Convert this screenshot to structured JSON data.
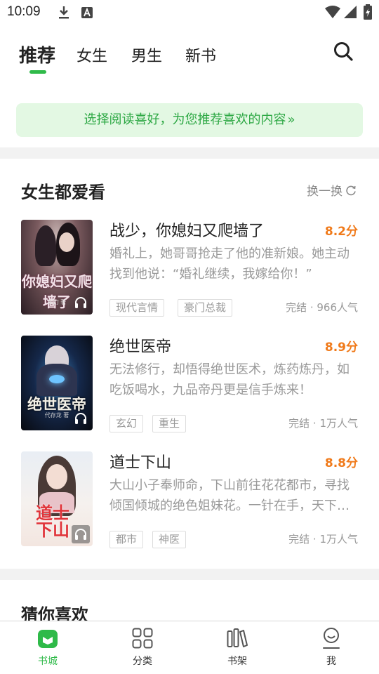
{
  "status_bar": {
    "time": "10:09",
    "icons": [
      "download-icon",
      "font-icon",
      "wifi-icon",
      "signal-icon",
      "battery-icon"
    ]
  },
  "header": {
    "tabs": [
      {
        "label": "推荐",
        "active": true
      },
      {
        "label": "女生",
        "active": false
      },
      {
        "label": "男生",
        "active": false
      },
      {
        "label": "新书",
        "active": false
      }
    ],
    "search_icon": "search-icon"
  },
  "preference_banner": {
    "text": "选择阅读喜好，为您推荐喜欢的内容",
    "chevron": "»"
  },
  "section_female": {
    "title": "女生都爱看",
    "refresh_label": "换一换",
    "books": [
      {
        "title": "战少，你媳妇又爬墙了",
        "score": "8.2分",
        "desc": "婚礼上，她哥哥抢走了他的准新娘。她主动找到他说：“婚礼继续，我嫁给你！”",
        "tags": [
          "现代言情",
          "豪门总裁"
        ],
        "meta": "完结 · 966人气",
        "cover_text": "你媳妇又爬墙了",
        "cover_author": "紫幻 著"
      },
      {
        "title": "绝世医帝",
        "score": "8.9分",
        "desc": "无法修行，却悟得绝世医术，炼药炼丹，如吃饭喝水，九品帝丹更是信手炼来！",
        "tags": [
          "玄幻",
          "重生"
        ],
        "meta": "完结 · 1万人气",
        "cover_text": "绝世医帝",
        "cover_author": "代存龙 著"
      },
      {
        "title": "道士下山",
        "score": "8.8分",
        "desc": "大山小子奉师命，下山前往花花都市，寻找倾国倾城的绝色姐妹花。一针在手，天下我有！",
        "tags": [
          "都市",
          "神医"
        ],
        "meta": "完结 · 1万人气",
        "cover_text": "道士下山",
        "cover_author": ""
      }
    ]
  },
  "section_guess": {
    "title": "猜你喜欢"
  },
  "bottom_nav": [
    {
      "label": "书城",
      "icon": "bookstore-icon",
      "active": true
    },
    {
      "label": "分类",
      "icon": "category-grid-icon",
      "active": false
    },
    {
      "label": "书架",
      "icon": "bookshelf-icon",
      "active": false
    },
    {
      "label": "我",
      "icon": "profile-icon",
      "active": false
    }
  ],
  "colors": {
    "accent": "#2fba49",
    "score": "#f07a1a",
    "banner_bg": "#e3f8e3",
    "banner_text": "#2da844"
  }
}
